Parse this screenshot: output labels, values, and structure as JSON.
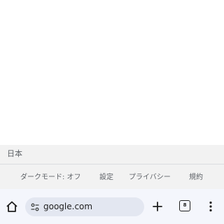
{
  "footer": {
    "region": "日本",
    "links": [
      {
        "label": "ダークモード: オフ"
      },
      {
        "label": "設定"
      },
      {
        "label": "プライバシー"
      },
      {
        "label": "規約"
      }
    ]
  },
  "toolbar": {
    "home_icon": "home-icon",
    "site_info_icon": "tune-icon",
    "url": "google.com",
    "new_tab_icon": "plus-icon",
    "tab_count": "8",
    "menu_icon": "more-vert-icon"
  },
  "colors": {
    "footer_bg": "#f2f2f2",
    "toolbar_bg": "#f4f6fc",
    "omnibox_bg": "#e3e7f1",
    "link_text": "#5f6368"
  }
}
